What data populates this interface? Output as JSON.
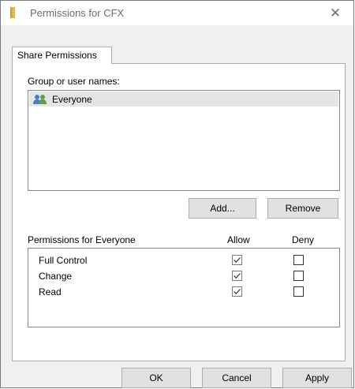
{
  "window": {
    "title": "Permissions for CFX",
    "close_glyph": "✕"
  },
  "tabs": [
    {
      "label": "Share Permissions",
      "active": true
    }
  ],
  "group_section": {
    "label": "Group or user names:",
    "users": [
      {
        "name": "Everyone",
        "icon": "users-icon",
        "selected": true
      }
    ],
    "add_button": "Add...",
    "remove_button": "Remove"
  },
  "permissions": {
    "header": "Permissions for Everyone",
    "allow_header": "Allow",
    "deny_header": "Deny",
    "rows": [
      {
        "name": "Full Control",
        "allow": true,
        "deny": false
      },
      {
        "name": "Change",
        "allow": true,
        "deny": false
      },
      {
        "name": "Read",
        "allow": true,
        "deny": false
      }
    ]
  },
  "footer": {
    "ok_button": "OK",
    "cancel_button": "Cancel",
    "apply_button": "Apply"
  },
  "colors": {
    "folder": "#e8b84a",
    "users_icon_primary": "#4a7fb5",
    "users_icon_secondary": "#5e9e4a"
  }
}
